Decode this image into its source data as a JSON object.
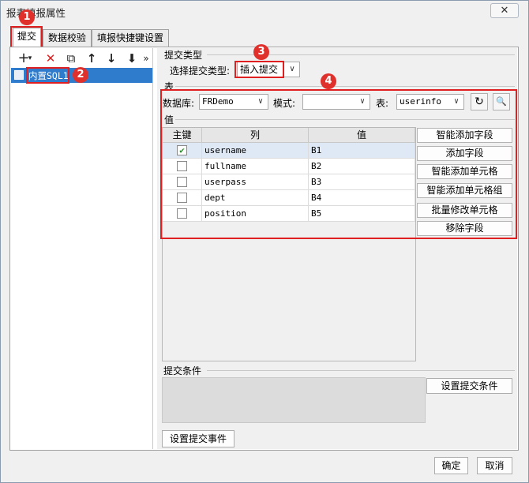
{
  "window": {
    "title": "报表填报属性",
    "close_glyph": "✕"
  },
  "tabs": [
    {
      "label": "提交"
    },
    {
      "label": "数据校验"
    },
    {
      "label": "填报快捷键设置"
    }
  ],
  "toolbar": {
    "add": "+",
    "add_dropdown": "▾",
    "delete": "✕",
    "copy": "⧉",
    "up": "↑",
    "down": "↓",
    "move": "⬇",
    "more": "»"
  },
  "tree": {
    "items": [
      {
        "label": "内置SQL1"
      }
    ]
  },
  "badges": [
    "1",
    "2",
    "3",
    "4"
  ],
  "submit_type": {
    "section_label": "提交类型",
    "field_label": "选择提交类型:",
    "value": "插入提交"
  },
  "table_section": {
    "label": "表",
    "db_label": "数据库:",
    "db_value": "FRDemo",
    "schema_label": "模式:",
    "schema_value": "",
    "table_label": "表:",
    "table_value": "userinfo",
    "refresh_glyph": "↻",
    "preview_glyph": "🔍"
  },
  "values_section": {
    "label": "值",
    "columns": [
      "主键",
      "列",
      "值"
    ],
    "rows": [
      {
        "key": true,
        "column": "username",
        "value": "B1"
      },
      {
        "key": false,
        "column": "fullname",
        "value": "B2"
      },
      {
        "key": false,
        "column": "userpass",
        "value": "B3"
      },
      {
        "key": false,
        "column": "dept",
        "value": "B4"
      },
      {
        "key": false,
        "column": "position",
        "value": "B5"
      }
    ],
    "check_glyph": "✔",
    "buttons": [
      "智能添加字段",
      "添加字段",
      "智能添加单元格",
      "智能添加单元格组",
      "批量修改单元格",
      "移除字段"
    ]
  },
  "condition": {
    "label": "提交条件",
    "button": "设置提交条件"
  },
  "event_button": "设置提交事件",
  "footer": {
    "ok": "确定",
    "cancel": "取消"
  },
  "colors": {
    "accent_red": "#e02020",
    "selection_blue": "#2f7ccc"
  }
}
